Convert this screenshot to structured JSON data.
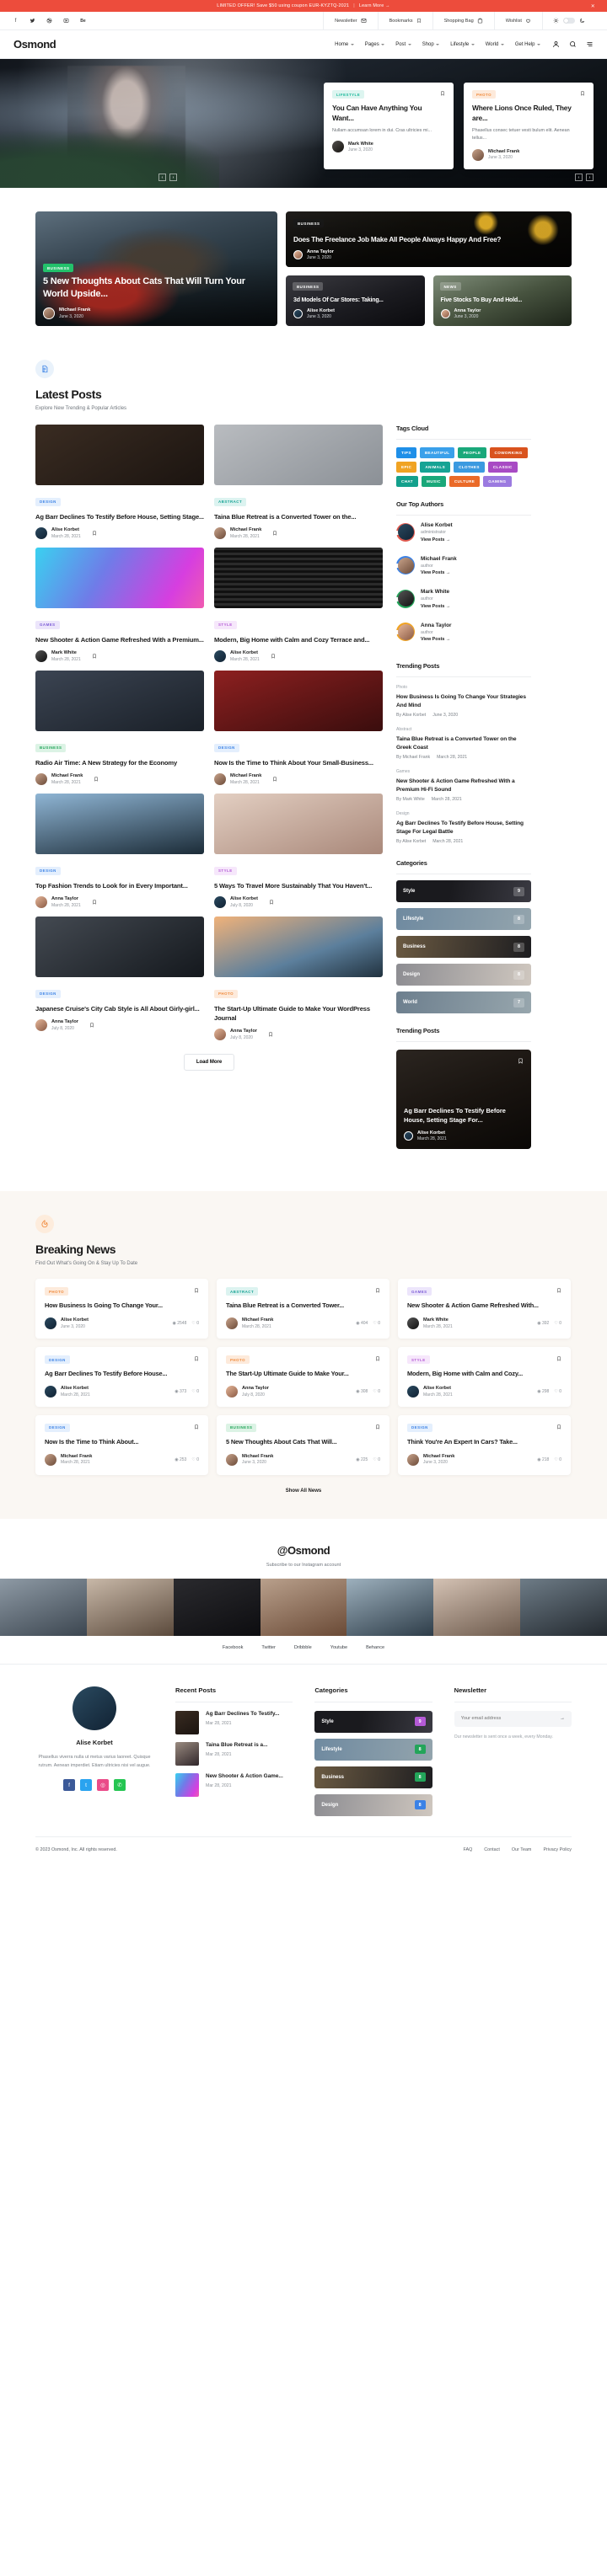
{
  "promo": {
    "text": "LIMITED OFFER! Save $50 using coupon EUR-KYZTQ-2021",
    "sep": "|",
    "link": "Learn More →",
    "close": "✕"
  },
  "utilbar": {
    "social": [
      "facebook-icon",
      "twitter-icon",
      "dribbble-icon",
      "youtube-icon",
      "behance-icon"
    ],
    "social_glyphs": [
      "f",
      "🐦",
      "◎",
      "▶",
      "Be"
    ],
    "items": [
      {
        "label": "Newsletter",
        "icon": "mail-icon"
      },
      {
        "label": "Bookmarks",
        "icon": "bookmark-icon"
      },
      {
        "label": "Shopping Bag",
        "icon": "bag-icon"
      },
      {
        "label": "Wishlist",
        "icon": "heart-icon"
      }
    ],
    "theme": {
      "sun": "sun-icon",
      "moon": "moon-icon"
    }
  },
  "nav": {
    "logo": "Osmond",
    "links": [
      "Home",
      "Pages",
      "Post",
      "Shop",
      "Lifestyle",
      "World",
      "Get Help"
    ],
    "icons": [
      "user-icon",
      "search-icon",
      "menu-icon"
    ]
  },
  "hero": {
    "cards": [
      {
        "category": "LIFESTYLE",
        "cat_color": "#19b89a",
        "cat_bg": "#ddf5f0",
        "title": "You Can Have Anything You Want...",
        "excerpt": "Nullam accumsan lorem in dui. Cras ultricies mi...",
        "author": "Mark White",
        "date": "June 3, 2020"
      },
      {
        "category": "PHOTO",
        "cat_color": "#f08a3c",
        "cat_bg": "#fdeadb",
        "title": "Where Lions Once Ruled, They are...",
        "excerpt": "Phasellus consec tetuer vesti bulum elit. Aenean tellus...",
        "author": "Michael Frank",
        "date": "June 3, 2020"
      }
    ],
    "nav_prev": "‹",
    "nav_next": "›",
    "pg_prev": "‹",
    "pg_next": "›"
  },
  "featured": {
    "big": {
      "category": "BUSINESS",
      "title": "5 New Thoughts About Cats That Will Turn Your World Upside...",
      "author": "Michael Frank",
      "date": "June 3, 2020"
    },
    "wide": {
      "category": "BUSINESS",
      "title": "Does The Freelance Job Make All People Always Happy And Free?",
      "author": "Anna Taylor",
      "date": "June 3, 2020"
    },
    "small": [
      {
        "category": "BUSINESS",
        "title": "3d Models Of Car Stores: Taking...",
        "author": "Alise Korbet",
        "date": "June 3, 2020"
      },
      {
        "category": "NEWS",
        "title": "Five Stocks To Buy And Hold...",
        "author": "Anna Taylor",
        "date": "June 3, 2020"
      }
    ]
  },
  "latest": {
    "icon": "document-icon",
    "title": "Latest Posts",
    "subtitle": "Explore New Trending & Popular Articles",
    "load_more": "Load More",
    "posts": [
      {
        "category": "DESIGN",
        "cat_color": "#3b82e6",
        "cat_bg": "#e4effd",
        "title": "Ag Barr Declines To Testify Before House, Setting Stage...",
        "author": "Alise Korbet",
        "date": "March 28, 2021",
        "thumb": "linear-gradient(150deg,#3a2c22,#1b1410)"
      },
      {
        "category": "ABSTRACT",
        "cat_color": "#16a394",
        "cat_bg": "#dcf3f0",
        "title": "Taina Blue Retreat is a Converted Tower on the...",
        "author": "Michael Frank",
        "date": "March 28, 2021",
        "thumb": "linear-gradient(150deg,#b9bcc0,#8b9096)"
      },
      {
        "category": "GAMES",
        "cat_color": "#7c5cd6",
        "cat_bg": "#ece5fb",
        "title": "New Shooter & Action Game Refreshed With a Premium...",
        "author": "Mark White",
        "date": "March 28, 2021",
        "thumb": "linear-gradient(120deg,#3ad1f0,#6f7ce8 40%,#d63ee0 80%,#f05ab0)"
      },
      {
        "category": "STYLE",
        "cat_color": "#b45ad6",
        "cat_bg": "#f6e7fb",
        "title": "Modern, Big Home with Calm and Cozy Terrace and...",
        "author": "Alise Korbet",
        "date": "March 28, 2021",
        "thumb": "repeating-linear-gradient(180deg,#2b2b2b 0 3px,#111 3px 6px)"
      },
      {
        "category": "BUSINESS",
        "cat_color": "#23a55a",
        "cat_bg": "#dcf3e5",
        "title": "Radio Air Time: A New Strategy for the Economy",
        "author": "Michael Frank",
        "date": "March 28, 2021",
        "thumb": "linear-gradient(160deg,#3b4452,#1a2028)"
      },
      {
        "category": "DESIGN",
        "cat_color": "#3b82e6",
        "cat_bg": "#e4effd",
        "title": "Now Is the Time to Think About Your Small-Business...",
        "author": "Michael Frank",
        "date": "March 28, 2021",
        "thumb": "linear-gradient(160deg,#8d2020,#3a0d0d)"
      },
      {
        "category": "DESIGN",
        "cat_color": "#3b82e6",
        "cat_bg": "#e4effd",
        "title": "Top Fashion Trends to Look for in Every Important...",
        "author": "Anna Taylor",
        "date": "March 28, 2021",
        "thumb": "linear-gradient(170deg,#8fb5d4,#1c2c38)"
      },
      {
        "category": "STYLE",
        "cat_color": "#b45ad6",
        "cat_bg": "#f6e7fb",
        "title": "5 Ways To Travel More Sustainably That You Haven't...",
        "author": "Alise Korbet",
        "date": "July 8, 2020",
        "thumb": "linear-gradient(160deg,#e3cfc2,#a9887a)"
      },
      {
        "category": "DESIGN",
        "cat_color": "#3b82e6",
        "cat_bg": "#e4effd",
        "title": "Japanese Cruise's City Cab Style is All About Girly-girl...",
        "author": "Anna Taylor",
        "date": "July 8, 2020",
        "thumb": "linear-gradient(150deg,#444a52,#14181d)"
      },
      {
        "category": "PHOTO",
        "cat_color": "#f08a3c",
        "cat_bg": "#fdeadb",
        "title": "The Start-Up Ultimate Guide to Make Your WordPress Journal",
        "author": "Anna Taylor",
        "date": "July 8, 2020",
        "thumb": "linear-gradient(160deg,#f0b27a,#5c7f9c 60%,#21323f)"
      }
    ]
  },
  "sidebar": {
    "tags_title": "Tags Cloud",
    "tags": [
      {
        "label": "TIPS",
        "color": "#1f8fe8"
      },
      {
        "label": "BEAUTIFUL",
        "color": "#3aa0ea"
      },
      {
        "label": "PEOPLE",
        "color": "#1aa87a"
      },
      {
        "label": "COWORKING",
        "color": "#d9531e"
      },
      {
        "label": "EPIC",
        "color": "#f0a323"
      },
      {
        "label": "ANIMALS",
        "color": "#16a394"
      },
      {
        "label": "CLOTHES",
        "color": "#3b9ae0"
      },
      {
        "label": "CLASSIC",
        "color": "#a84bc4"
      },
      {
        "label": "CHAT",
        "color": "#13a08c"
      },
      {
        "label": "MUSIC",
        "color": "#1aa87a"
      },
      {
        "label": "CULTURE",
        "color": "#ea6a28"
      },
      {
        "label": "GAMING",
        "color": "#9b7ae0"
      }
    ],
    "authors_title": "Our Top Authors",
    "authors": [
      {
        "name": "Alise Korbet",
        "role": "administrator",
        "link": "View Posts  →",
        "ring": "#e05a4f",
        "av": "linear-gradient(140deg,#2a4a60,#123)"
      },
      {
        "name": "Michael Frank",
        "role": "author",
        "link": "View Posts  →",
        "ring": "#3b82e6",
        "av": "linear-gradient(140deg,#c9a48c,#6b4a38)"
      },
      {
        "name": "Mark White",
        "role": "author",
        "link": "View Posts  →",
        "ring": "#23a55a",
        "av": "linear-gradient(140deg,#555,#111)"
      },
      {
        "name": "Anna Taylor",
        "role": "author",
        "link": "View Posts  →",
        "ring": "#f0a323",
        "av": "linear-gradient(140deg,#e6b79a,#8a5a44)"
      }
    ],
    "trending_title": "Trending Posts",
    "trending": [
      {
        "cat": "Photo",
        "title": "How Business Is Going To Change Your Strategies And Mind",
        "by": "By Alise Korbet",
        "date": "June 3, 2020"
      },
      {
        "cat": "Abstract",
        "title": "Taina Blue Retreat is a Converted Tower on the Greek Coast",
        "by": "By Michael Frank",
        "date": "March 28, 2021"
      },
      {
        "cat": "Games",
        "title": "New Shooter & Action Game Refreshed With a Premium Hi-Fi Sound",
        "by": "By Mark White",
        "date": "March 28, 2021"
      },
      {
        "cat": "Design",
        "title": "Ag Barr Declines To Testify Before House, Setting Stage For Legal Battle",
        "by": "By Alise Korbet",
        "date": "March 28, 2021"
      }
    ],
    "categories_title": "Categories",
    "categories": [
      {
        "name": "Style",
        "count": "9",
        "bg": "linear-gradient(100deg,#1a1a1e 40%,#3a3a42)"
      },
      {
        "name": "Lifestyle",
        "count": "8",
        "bg": "linear-gradient(100deg,#6f8aa0,#93a4ad)"
      },
      {
        "name": "Business",
        "count": "8",
        "bg": "linear-gradient(100deg,#6b5a42,#1d1d20)"
      },
      {
        "name": "Design",
        "count": "8",
        "bg": "linear-gradient(100deg,#8d8d92,#cfc7bf)"
      },
      {
        "name": "World",
        "count": "7",
        "bg": "linear-gradient(100deg,#6d7f8e,#97a6ad)"
      }
    ],
    "trending2_title": "Trending Posts",
    "trending2": {
      "title": "Ag Barr Declines To Testify Before House, Setting Stage For...",
      "author": "Alise Korbet",
      "date": "March 28, 2021",
      "bookmark": "bookmark-icon"
    }
  },
  "breaking": {
    "icon": "fire-icon",
    "title": "Breaking News",
    "subtitle": "Find Out What's Going On & Stay Up To Date",
    "show_all": "Show All News",
    "cards": [
      {
        "category": "PHOTO",
        "cat_color": "#f08a3c",
        "cat_bg": "#fdeadb",
        "title": "How Business Is Going To Change Your...",
        "author": "Alise Korbet",
        "date": "June 3, 2020",
        "views": "2548",
        "comments": "0"
      },
      {
        "category": "ABSTRACT",
        "cat_color": "#16a394",
        "cat_bg": "#dcf3f0",
        "title": "Taina Blue Retreat is a Converted Tower...",
        "author": "Michael Frank",
        "date": "March 28, 2021",
        "views": "404",
        "comments": "0"
      },
      {
        "category": "GAMES",
        "cat_color": "#7c5cd6",
        "cat_bg": "#ece5fb",
        "title": "New Shooter & Action Game Refreshed With...",
        "author": "Mark White",
        "date": "March 28, 2021",
        "views": "392",
        "comments": "0"
      },
      {
        "category": "DESIGN",
        "cat_color": "#3b82e6",
        "cat_bg": "#e4effd",
        "title": "Ag Barr Declines To Testify Before House...",
        "author": "Alise Korbet",
        "date": "March 28, 2021",
        "views": "373",
        "comments": "0"
      },
      {
        "category": "PHOTO",
        "cat_color": "#f08a3c",
        "cat_bg": "#fdeadb",
        "title": "The Start-Up Ultimate Guide to Make Your...",
        "author": "Anna Taylor",
        "date": "July 8, 2020",
        "views": "308",
        "comments": "0"
      },
      {
        "category": "STYLE",
        "cat_color": "#b45ad6",
        "cat_bg": "#f6e7fb",
        "title": "Modern, Big Home with Calm and Cozy...",
        "author": "Alise Korbet",
        "date": "March 28, 2021",
        "views": "298",
        "comments": "0"
      },
      {
        "category": "DESIGN",
        "cat_color": "#3b82e6",
        "cat_bg": "#e4effd",
        "title": "Now Is the Time to Think About...",
        "author": "Michael Frank",
        "date": "March 28, 2021",
        "views": "253",
        "comments": "0"
      },
      {
        "category": "BUSINESS",
        "cat_color": "#23a55a",
        "cat_bg": "#dcf3e5",
        "title": "5 New Thoughts About Cats That Will...",
        "author": "Michael Frank",
        "date": "June 3, 2020",
        "views": "225",
        "comments": "0"
      },
      {
        "category": "DESIGN",
        "cat_color": "#3b82e6",
        "cat_bg": "#e4effd",
        "title": "Think You're An Expert In Cars? Take...",
        "author": "Michael Frank",
        "date": "June 3, 2020",
        "views": "218",
        "comments": "0"
      }
    ]
  },
  "instagram": {
    "handle": "@Osmond",
    "subtitle": "Subscribe to our Instagram account",
    "links": [
      "Facebook",
      "Twitter",
      "Dribbble",
      "Youtube",
      "Behance"
    ]
  },
  "footer": {
    "profile": {
      "name": "Alise Korbet",
      "bio": "Phasellus viverra nulla ut metus varius laoreet. Quisque rutrum. Aenean imperdiet. Etiam ultricies nisi vel augue.",
      "socials": [
        {
          "name": "facebook-icon",
          "glyph": "f",
          "color": "#3b5998"
        },
        {
          "name": "twitter-icon",
          "glyph": "t",
          "color": "#2aa3ef"
        },
        {
          "name": "dribbble-icon",
          "glyph": "◎",
          "color": "#ea4c89"
        },
        {
          "name": "whatsapp-icon",
          "glyph": "✆",
          "color": "#25c552"
        }
      ]
    },
    "recent_title": "Recent Posts",
    "recent": [
      {
        "title": "Ag Barr Declines To Testify...",
        "date": "Mar 28, 2021",
        "thumb": "linear-gradient(150deg,#3a2c22,#1b1410)"
      },
      {
        "title": "Taina Blue Retreat is a...",
        "date": "Mar 28, 2021",
        "thumb": "linear-gradient(150deg,#9a8b80,#30262a)"
      },
      {
        "title": "New Shooter & Action Game...",
        "date": "Mar 28, 2021",
        "thumb": "linear-gradient(120deg,#3ad1f0,#6f7ce8 40%,#d63ee0 80%,#f05ab0)"
      }
    ],
    "categories_title": "Categories",
    "categories": [
      {
        "name": "Style",
        "count": "9",
        "bg": "linear-gradient(100deg,#1a1a1e 40%,#3a3a42)",
        "badge": "#b45ad6"
      },
      {
        "name": "Lifestyle",
        "count": "8",
        "bg": "linear-gradient(100deg,#6f8aa0,#93a4ad)",
        "badge": "#23a55a"
      },
      {
        "name": "Business",
        "count": "8",
        "bg": "linear-gradient(100deg,#6b5a42,#1d1d20)",
        "badge": "#23a55a"
      },
      {
        "name": "Design",
        "count": "8",
        "bg": "linear-gradient(100deg,#8d8d92,#cfc7bf)",
        "badge": "#3b82e6"
      }
    ],
    "newsletter_title": "Newsletter",
    "newsletter_placeholder": "Your email address",
    "newsletter_submit": "→",
    "newsletter_note": "Our newsletter is sent once a week, every Monday.",
    "copyright": "© 2023 Osmond, Inc. All rights reserved.",
    "links": [
      "FAQ",
      "Contact",
      "Our Team",
      "Privacy Policy"
    ]
  }
}
